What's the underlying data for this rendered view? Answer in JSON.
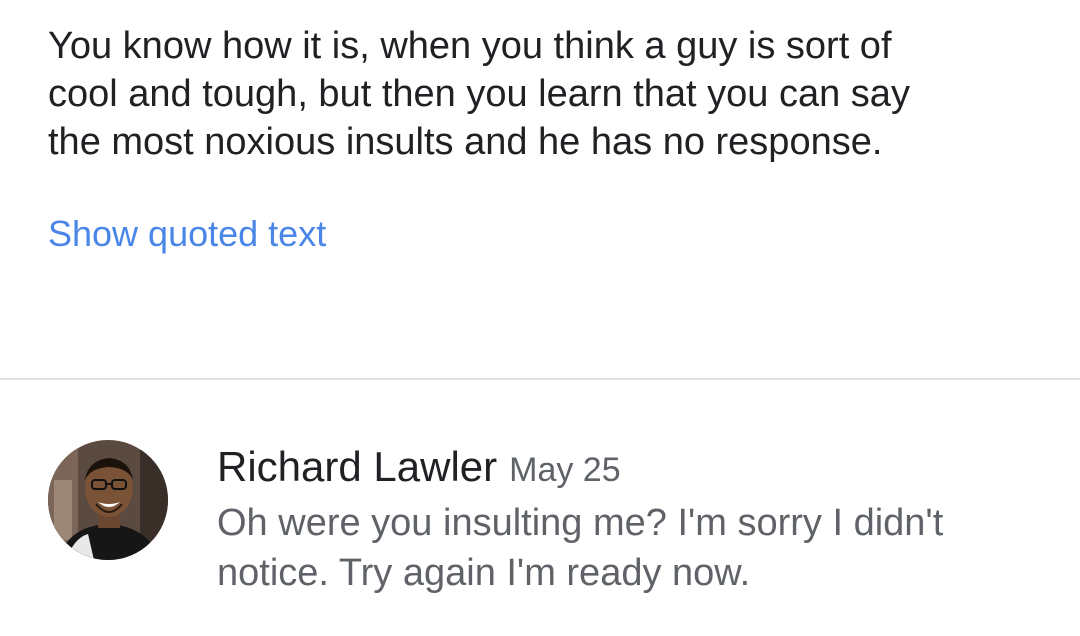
{
  "message": {
    "body_lines": [
      "You know how it is, when you think a guy is sort of",
      "cool and tough, but then you learn that you can say",
      "the most noxious insults and he has no response."
    ],
    "show_quoted_label": "Show quoted text"
  },
  "reply": {
    "sender": "Richard Lawler",
    "date": "May 25",
    "snippet_lines": [
      "Oh were you insulting me? I'm sorry I didn't",
      "notice. Try again I'm ready now."
    ]
  },
  "colors": {
    "link": "#4a86e8",
    "body_text": "#202124",
    "secondary_text": "#5f6368",
    "divider": "#e0e0e0"
  },
  "icons": {
    "avatar": "avatar"
  }
}
